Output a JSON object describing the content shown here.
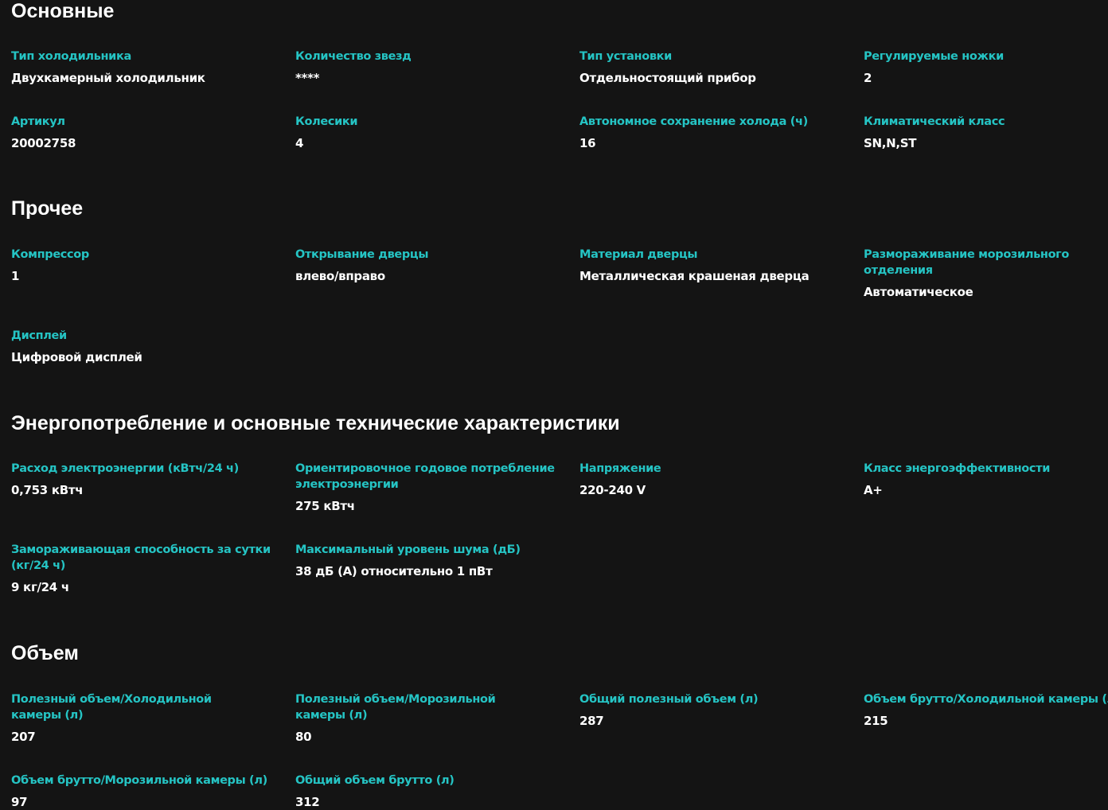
{
  "sections": [
    {
      "title": "Основные",
      "items": [
        {
          "label": "Тип холодильника",
          "value": "Двухкамерный холодильник"
        },
        {
          "label": "Количество звезд",
          "value": "****"
        },
        {
          "label": "Тип установки",
          "value": "Отдельностоящий прибор"
        },
        {
          "label": "Регулируемые ножки",
          "value": "2"
        },
        {
          "label": "Артикул",
          "value": "20002758"
        },
        {
          "label": "Колесики",
          "value": "4"
        },
        {
          "label": "Автономное сохранение холода (ч)",
          "value": "16"
        },
        {
          "label": "Климатический класс",
          "value": "SN,N,ST"
        }
      ]
    },
    {
      "title": "Прочее",
      "items": [
        {
          "label": "Компрессор",
          "value": "1"
        },
        {
          "label": "Открывание дверцы",
          "value": "влево/вправо"
        },
        {
          "label": "Материал дверцы",
          "value": "Металлическая крашеная дверца"
        },
        {
          "label": "Размораживание морозильного отделения",
          "value": "Автоматическое"
        },
        {
          "label": "Дисплей",
          "value": "Цифровой дисплей"
        }
      ]
    },
    {
      "title": "Энергопотребление и основные технические характеристики",
      "items": [
        {
          "label": "Расход электроэнергии (кВтч/24 ч)",
          "value": "0,753 кВтч"
        },
        {
          "label": "Ориентировочное годовое потребление электроэнергии",
          "value": "275 кВтч"
        },
        {
          "label": "Напряжение",
          "value": "220-240 V"
        },
        {
          "label": "Класс энергоэффективности",
          "value": "A+"
        },
        {
          "label": "Замораживающая способность за сутки (кг/24 ч)",
          "value": "9 кг/24 ч"
        },
        {
          "label": "Максимальный уровень шума (дБ)",
          "value": "38 дБ (А) относительно 1 пВт"
        }
      ]
    },
    {
      "title": "Объем",
      "items": [
        {
          "label": "Полезный объем/Холодильной камеры (л)",
          "value": "207"
        },
        {
          "label": "Полезный объем/Морозильной камеры (л)",
          "value": "80"
        },
        {
          "label": "Общий полезный объем (л)",
          "value": "287"
        },
        {
          "label": "Объем брутто/Холодильной камеры (л)",
          "value": "215"
        },
        {
          "label": "Объем брутто/Морозильной камеры (л)",
          "value": "97"
        },
        {
          "label": "Общий объем брутто (л)",
          "value": "312"
        }
      ]
    }
  ],
  "colors": {
    "background": "#141414",
    "label_accent": "#25c4c4",
    "text": "#ffffff"
  }
}
